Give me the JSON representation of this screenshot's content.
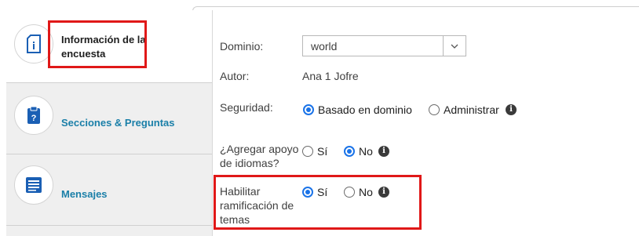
{
  "sidebar": {
    "items": [
      {
        "label_line1": "Información de la",
        "label_line2": "encuesta",
        "icon": "survey-info-icon",
        "active": true
      },
      {
        "label": "Secciones & Preguntas",
        "icon": "clipboard-question-icon",
        "active": false
      },
      {
        "label": "Mensajes",
        "icon": "message-lines-icon",
        "active": false
      }
    ]
  },
  "form": {
    "dominio": {
      "label": "Dominio:",
      "value": "world"
    },
    "autor": {
      "label": "Autor:",
      "value": "Ana 1 Jofre"
    },
    "seguridad": {
      "label": "Seguridad:",
      "options": [
        {
          "label": "Basado en dominio",
          "checked": true
        },
        {
          "label": "Administrar",
          "checked": false
        }
      ]
    },
    "idiomas": {
      "label_line1": "¿Agregar apoyo",
      "label_line2": "de idiomas?",
      "options": [
        {
          "label": "Sí",
          "checked": false
        },
        {
          "label": "No",
          "checked": true
        }
      ]
    },
    "ramificacion": {
      "label_line1": "Habilitar",
      "label_line2": "ramificación de",
      "label_line3": "temas",
      "options": [
        {
          "label": "Sí",
          "checked": true
        },
        {
          "label": "No",
          "checked": false
        }
      ]
    }
  },
  "colors": {
    "accent": "#1a73e8",
    "nav_text": "#1a7fa8",
    "highlight": "#e01818"
  }
}
